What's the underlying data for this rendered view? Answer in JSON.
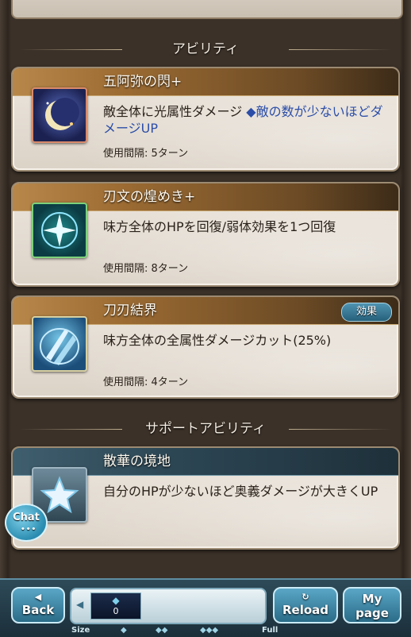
{
  "sections": {
    "abilities_title": "アビリティ",
    "support_title": "サポートアビリティ"
  },
  "abilities": [
    {
      "name": "五阿弥の閃+",
      "description": "敵全体に光属性ダメージ",
      "note": "◆敵の数が少ないほどダメージUP",
      "cooldown": "使用間隔: 5ターン",
      "icon": "crescent-moon-icon"
    },
    {
      "name": "刃文の煌めき+",
      "description": "味方全体のHPを回復/弱体効果を1つ回復",
      "cooldown": "使用間隔: 8ターン",
      "icon": "sparkle-heal-icon"
    },
    {
      "name": "刀刃結界",
      "badge": "効果",
      "description": "味方全体の全属性ダメージカット(25%)",
      "cooldown": "使用間隔: 4ターン",
      "icon": "blade-barrier-icon"
    }
  ],
  "support": {
    "name": "散華の境地",
    "description": "自分のHPが少ないほど奥義ダメージが大きくUP",
    "icon": "star-icon"
  },
  "chat": {
    "label": "Chat",
    "dots": "•••"
  },
  "bottom_bar": {
    "back_label": "Back",
    "reload_label": "Reload",
    "mypage_label_1": "My",
    "mypage_label_2": "page",
    "slider_value": "0",
    "size_label": "Size",
    "full_label": "Full"
  }
}
